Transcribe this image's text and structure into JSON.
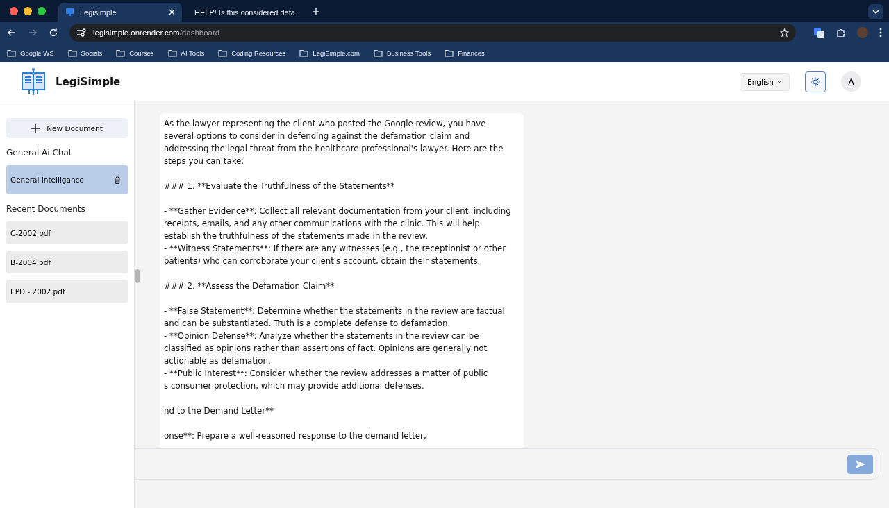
{
  "browser": {
    "tabs": [
      {
        "title": "Legisimple",
        "selected": true
      },
      {
        "title": "HELP! Is this considered defa",
        "selected": false
      }
    ],
    "url_host": "legisimple.onrender.com",
    "url_path": "/dashboard",
    "bookmarks": [
      "Google WS",
      "Socials",
      "Courses",
      "AI Tools",
      "Coding Resources",
      "LegiSimple.com",
      "Business Tools",
      "Finances"
    ]
  },
  "header": {
    "brand": "LegiSimple",
    "language": "English",
    "avatar": "A"
  },
  "sidebar": {
    "new_button": "New Document",
    "chat_heading": "General Ai Chat",
    "chats": [
      {
        "title": "General Intelligance",
        "selected": true
      }
    ],
    "docs_heading": "Recent Documents",
    "documents": [
      {
        "title": "C-2002.pdf",
        "selected": false
      },
      {
        "title": "B-2004.pdf",
        "selected": false
      },
      {
        "title": "EPD - 2002.pdf",
        "selected": false
      }
    ]
  },
  "message": {
    "blocks": [
      {
        "lines": [
          "As the lawyer representing the client who posted the Google review, you have",
          "several options to consider in defending against the defamation claim and",
          "addressing the legal threat from the healthcare professional's lawyer. Here are the",
          "steps you can take:"
        ]
      },
      {
        "lines": [
          "### 1. **Evaluate the Truthfulness of the Statements**"
        ]
      },
      {
        "lines": [
          "- **Gather Evidence**: Collect all relevant documentation from your client, including",
          "receipts, emails, and any other communications with the clinic. This will help",
          "establish the truthfulness of the statements made in the review.",
          "- **Witness Statements**: If there are any witnesses (e.g., the receptionist or other",
          "patients) who can corroborate your client's account, obtain their statements."
        ]
      },
      {
        "lines": [
          "### 2. **Assess the Defamation Claim**"
        ]
      },
      {
        "lines": [
          "- **False Statement**: Determine whether the statements in the review are factual",
          "and can be substantiated. Truth is a complete defense to defamation.",
          "- **Opinion Defense**: Analyze whether the statements in the review can be",
          "classified as opinions rather than assertions of fact. Opinions are generally not",
          "actionable as defamation.",
          "- **Public Interest**: Consider whether the review addresses a matter of public",
          "s consumer protection, which may provide additional defenses."
        ]
      },
      {
        "lines": [
          "nd to the Demand Letter**"
        ]
      },
      {
        "lines": [
          "onse**: Prepare a well-reasoned response to the demand letter,"
        ]
      }
    ]
  }
}
